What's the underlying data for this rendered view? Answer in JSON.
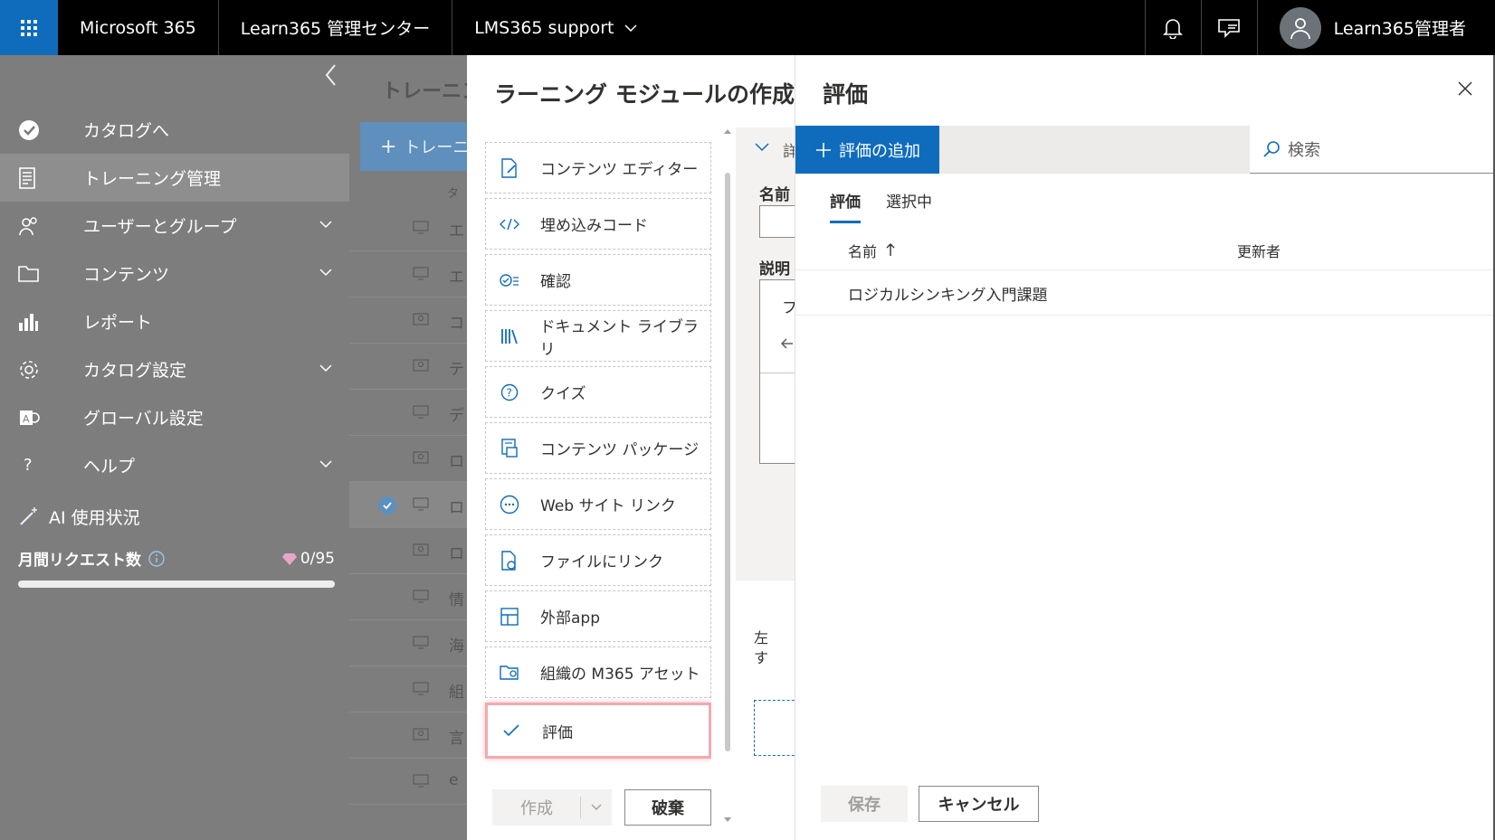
{
  "topbar": {
    "brand": "Microsoft 365",
    "admin_center": "Learn365 管理センター",
    "site": "LMS365 support",
    "user": "Learn365管理者"
  },
  "sidebar": {
    "items": [
      {
        "label": "カタログへ",
        "icon": "catalog-check-icon",
        "chevron": false
      },
      {
        "label": "トレーニング管理",
        "icon": "training-doc-icon",
        "chevron": false,
        "selected": true
      },
      {
        "label": "ユーザーとグループ",
        "icon": "users-icon",
        "chevron": true
      },
      {
        "label": "コンテンツ",
        "icon": "folder-icon",
        "chevron": true
      },
      {
        "label": "レポート",
        "icon": "report-chart-icon",
        "chevron": false
      },
      {
        "label": "カタログ設定",
        "icon": "gear-icon",
        "chevron": true
      },
      {
        "label": "グローバル設定",
        "icon": "global-settings-icon",
        "chevron": false
      },
      {
        "label": "ヘルプ",
        "icon": "help-icon",
        "chevron": true
      }
    ],
    "ai_title": "AI 使用状況",
    "monthly_requests_label": "月間リクエスト数",
    "monthly_requests_value": "0/95",
    "usage_fraction": 0
  },
  "background_list": {
    "title": "トレーニング",
    "new_button": "トレーニ",
    "column": "タ",
    "rows": [
      "エ",
      "エ",
      "コ",
      "テ",
      "デ",
      "ロ",
      "ロ",
      "ロ",
      "情",
      "海",
      "組",
      "言",
      "e"
    ]
  },
  "create_panel": {
    "title": "ラーニング モジュールの作成",
    "items": [
      {
        "label": "コンテンツ エディター",
        "icon": "content-editor-icon"
      },
      {
        "label": "埋め込みコード",
        "icon": "embed-code-icon"
      },
      {
        "label": "確認",
        "icon": "checklist-icon"
      },
      {
        "label": "ドキュメント ライブラリ",
        "icon": "library-icon"
      },
      {
        "label": "クイズ",
        "icon": "quiz-icon"
      },
      {
        "label": "コンテンツ パッケージ",
        "icon": "package-icon"
      },
      {
        "label": "Web サイト リンク",
        "icon": "link-icon"
      },
      {
        "label": "ファイルにリンク",
        "icon": "file-link-icon"
      },
      {
        "label": "外部app",
        "icon": "external-app-icon"
      },
      {
        "label": "組織の M365 アセット",
        "icon": "m365-asset-icon"
      },
      {
        "label": "評価",
        "icon": "checkmark-icon",
        "highlighted": true
      }
    ],
    "section_label": "詳",
    "name_label": "名前",
    "desc_label": "説明",
    "desc_text": "フ",
    "hint_text_1": "左",
    "hint_text_2": "す",
    "create_button": "作成",
    "discard_button": "破棄"
  },
  "eval_panel": {
    "title": "評価",
    "add_button": "評価の追加",
    "search_placeholder": "検索",
    "tabs": [
      "評価",
      "選択中"
    ],
    "col_name": "名前",
    "col_updater": "更新者",
    "rows": [
      {
        "name": "ロジカルシンキング入門課題",
        "updater": ""
      }
    ],
    "save_button": "保存",
    "cancel_button": "キャンセル"
  },
  "colors": {
    "accent": "#0f6cbd",
    "highlight": "#f2aab0",
    "overlay": "#7d7d7d"
  }
}
